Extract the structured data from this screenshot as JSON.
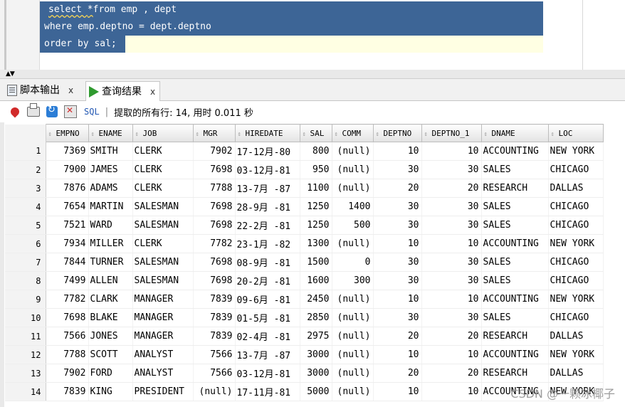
{
  "editor": {
    "lines": [
      {
        "pre": "select ",
        "kw": "*",
        "post": "from emp , dept"
      },
      {
        "text": "where emp.deptno = dept.deptno"
      },
      {
        "text": "order by sal;"
      }
    ]
  },
  "splitter": {
    "arrows": "▲▼"
  },
  "tabs": [
    {
      "label": "脚本输出",
      "close": "x",
      "icon": "document-icon"
    },
    {
      "label": "查询结果",
      "close": "x",
      "icon": "play-icon",
      "active": true
    }
  ],
  "toolbar": {
    "sql_label": "SQL",
    "separator": "|",
    "status": "提取的所有行: 14, 用时 0.011 秒"
  },
  "grid": {
    "columns": [
      "EMPNO",
      "ENAME",
      "JOB",
      "MGR",
      "HIREDATE",
      "SAL",
      "COMM",
      "DEPTNO",
      "DEPTNO_1",
      "DNAME",
      "LOC"
    ],
    "rows": [
      [
        "1",
        "7369",
        "SMITH",
        "CLERK",
        "7902",
        "17-12月-80",
        "800",
        "(null)",
        "10",
        "10",
        "ACCOUNTING",
        "NEW YORK"
      ],
      [
        "2",
        "7900",
        "JAMES",
        "CLERK",
        "7698",
        "03-12月-81",
        "950",
        "(null)",
        "30",
        "30",
        "SALES",
        "CHICAGO"
      ],
      [
        "3",
        "7876",
        "ADAMS",
        "CLERK",
        "7788",
        "13-7月 -87",
        "1100",
        "(null)",
        "20",
        "20",
        "RESEARCH",
        "DALLAS"
      ],
      [
        "4",
        "7654",
        "MARTIN",
        "SALESMAN",
        "7698",
        "28-9月 -81",
        "1250",
        "1400",
        "30",
        "30",
        "SALES",
        "CHICAGO"
      ],
      [
        "5",
        "7521",
        "WARD",
        "SALESMAN",
        "7698",
        "22-2月 -81",
        "1250",
        "500",
        "30",
        "30",
        "SALES",
        "CHICAGO"
      ],
      [
        "6",
        "7934",
        "MILLER",
        "CLERK",
        "7782",
        "23-1月 -82",
        "1300",
        "(null)",
        "10",
        "10",
        "ACCOUNTING",
        "NEW YORK"
      ],
      [
        "7",
        "7844",
        "TURNER",
        "SALESMAN",
        "7698",
        "08-9月 -81",
        "1500",
        "0",
        "30",
        "30",
        "SALES",
        "CHICAGO"
      ],
      [
        "8",
        "7499",
        "ALLEN",
        "SALESMAN",
        "7698",
        "20-2月 -81",
        "1600",
        "300",
        "30",
        "30",
        "SALES",
        "CHICAGO"
      ],
      [
        "9",
        "7782",
        "CLARK",
        "MANAGER",
        "7839",
        "09-6月 -81",
        "2450",
        "(null)",
        "10",
        "10",
        "ACCOUNTING",
        "NEW YORK"
      ],
      [
        "10",
        "7698",
        "BLAKE",
        "MANAGER",
        "7839",
        "01-5月 -81",
        "2850",
        "(null)",
        "30",
        "30",
        "SALES",
        "CHICAGO"
      ],
      [
        "11",
        "7566",
        "JONES",
        "MANAGER",
        "7839",
        "02-4月 -81",
        "2975",
        "(null)",
        "20",
        "20",
        "RESEARCH",
        "DALLAS"
      ],
      [
        "12",
        "7788",
        "SCOTT",
        "ANALYST",
        "7566",
        "13-7月 -87",
        "3000",
        "(null)",
        "10",
        "10",
        "ACCOUNTING",
        "NEW YORK"
      ],
      [
        "13",
        "7902",
        "FORD",
        "ANALYST",
        "7566",
        "03-12月-81",
        "3000",
        "(null)",
        "20",
        "20",
        "RESEARCH",
        "DALLAS"
      ],
      [
        "14",
        "7839",
        "KING",
        "PRESIDENT",
        "(null)",
        "17-11月-81",
        "5000",
        "(null)",
        "10",
        "10",
        "ACCOUNTING",
        "NEW YORK"
      ]
    ]
  },
  "watermark": "CSDN @一颗冰椰子"
}
